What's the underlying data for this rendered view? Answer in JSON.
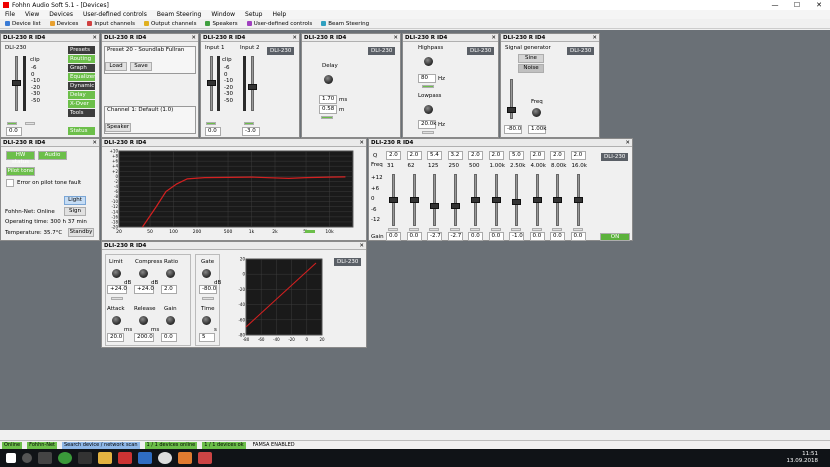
{
  "window": {
    "title": "Fohhn Audio Soft 5.1 - [Devices]",
    "min": "—",
    "max": "☐",
    "close": "✕"
  },
  "menu": [
    "File",
    "View",
    "Devices",
    "User-defined controls",
    "Beam Steering",
    "Window",
    "Setup",
    "Help"
  ],
  "toolbar": [
    {
      "label": "Device list",
      "color": "#3a7bd5"
    },
    {
      "label": "Devices",
      "color": "#e8a030"
    },
    {
      "label": "Input channels",
      "color": "#d04040"
    },
    {
      "label": "Output channels",
      "color": "#e0b020"
    },
    {
      "label": "Speakers",
      "color": "#40a040"
    },
    {
      "label": "User-defined controls",
      "color": "#a040c0"
    },
    {
      "label": "Beam Steering",
      "color": "#30a0c0"
    }
  ],
  "panels": {
    "p1": {
      "title": "DLI-230 R ID4",
      "device": "DLI-230",
      "meter_top": "clip",
      "meter_scale": [
        "-6",
        "0",
        "-10",
        "-20",
        "-30",
        "-50"
      ],
      "value": "0.0",
      "nav": [
        "Presets",
        "Routing",
        "Graph",
        "Equalizer",
        "Dynamic",
        "Delay",
        "X-Over",
        "Tools",
        "Status"
      ]
    },
    "p2": {
      "title": "DLI-230 R ID4",
      "preset": "Preset 20 - Soundlab Fullran",
      "load": "Load",
      "save": "Save",
      "channel": "Channel 1: Default (1.0)",
      "speaker": "Speaker"
    },
    "p3": {
      "title": "DLI-230 R ID4",
      "device": "DLI-230",
      "input1": "Input 1",
      "input2": "Input 2",
      "clip": "clip",
      "val1": "0.0",
      "val2": "-3.0",
      "scale": [
        "-6",
        "0",
        "-10",
        "-20",
        "-30",
        "-50"
      ]
    },
    "p4": {
      "title": "DLI-230 R ID4",
      "device": "DLI-230",
      "label": "Delay",
      "ms_val": "1.70",
      "ms_unit": "ms",
      "m_val": "0.58",
      "m_unit": "m"
    },
    "p5": {
      "title": "DLI-230 R ID4",
      "device": "DLI-230",
      "highpass": "Highpass",
      "hp_val": "80",
      "hp_unit": "Hz",
      "lowpass": "Lowpass",
      "lp_val": "20.0k",
      "lp_unit": "Hz"
    },
    "p6": {
      "title": "DLI-230 R ID4",
      "device": "DLI-230",
      "label": "Signal generator",
      "sine": "Sine",
      "noise": "Noise",
      "freq_label": "Freq",
      "level": "-80.0",
      "freq": "1.00k"
    },
    "p7": {
      "title": "DLI-230 R ID4",
      "hw_status": "HW status",
      "audio": "Audio",
      "pilot_tone": "Pilot tone",
      "error": "Error on pilot tone fault",
      "light": "Light",
      "sign": "Sign",
      "net": "Fohhn-Net: Online",
      "op_time": "Operating time: 300 h 37 min",
      "temp": "Temperature: 35.7°C",
      "standby": "Standby"
    },
    "p8": {
      "title": "DLI-230 R ID4",
      "y_ticks": [
        "+10",
        "+8",
        "+6",
        "+4",
        "+2",
        "0",
        "-2",
        "-4",
        "-6",
        "-8",
        "-10",
        "-12",
        "-14",
        "-16",
        "-18",
        "-20"
      ],
      "x_ticks": [
        "20",
        "50",
        "100",
        "200",
        "500",
        "1k",
        "2k",
        "5k",
        "10k"
      ]
    },
    "p9": {
      "title": "DLI-230 R ID4",
      "device": "DLI-230",
      "q_label": "Q",
      "freq_label": "Freq",
      "gain_label": "Gain",
      "scale": [
        "+12",
        "+6",
        "0",
        "-6",
        "-12"
      ],
      "q": [
        "2.0",
        "2.0",
        "5.4",
        "3.2",
        "2.0",
        "2.0",
        "5.0",
        "2.0",
        "2.0",
        "2.0"
      ],
      "freq": [
        "31",
        "62",
        "125",
        "250",
        "500",
        "1.00k",
        "2.50k",
        "4.00k",
        "8.00k",
        "16.0k"
      ],
      "gain": [
        "0.0",
        "0.0",
        "-2.7",
        "-2.7",
        "0.0",
        "0.0",
        "-1.0",
        "0.0",
        "0.0",
        "0.0"
      ],
      "on": "ON"
    },
    "p10": {
      "title": "DLI-230 R ID4",
      "device": "DLI-230",
      "limit": "Limit",
      "compress": "Compress",
      "ratio": "Ratio",
      "gate": "Gate",
      "limit_val": "+24.0",
      "compress_val": "+24.0",
      "ratio_val": "2.0",
      "gate_val": "-80.0",
      "db": "dB",
      "attack": "Attack",
      "release": "Release",
      "gain": "Gain",
      "time": "Time",
      "attack_val": "20.0",
      "release_val": "200.0",
      "gain_val": "0.0",
      "time_val": "5",
      "ms": "ms",
      "s": "s",
      "x_ticks": [
        "-80",
        "-60",
        "-40",
        "-20",
        "0",
        "20"
      ],
      "y_ticks": [
        "20",
        "0",
        "-20",
        "-40",
        "-60",
        "-80"
      ]
    }
  },
  "statusbar": [
    {
      "label": "Online",
      "bg": "#6cbf4a"
    },
    {
      "label": "Fohhn-Net",
      "bg": "#6cbf4a"
    },
    {
      "label": "Search device / network scan",
      "bg": "#8fb8e8"
    },
    {
      "label": "1 / 1 devices online",
      "bg": "#6cbf4a"
    },
    {
      "label": "1 / 1 devices ok",
      "bg": "#6cbf4a"
    },
    {
      "label": "FAMSA ENABLED",
      "bg": "#f0f0f0"
    }
  ],
  "taskbar": {
    "time": "11:51",
    "date": "13.09.2018"
  }
}
